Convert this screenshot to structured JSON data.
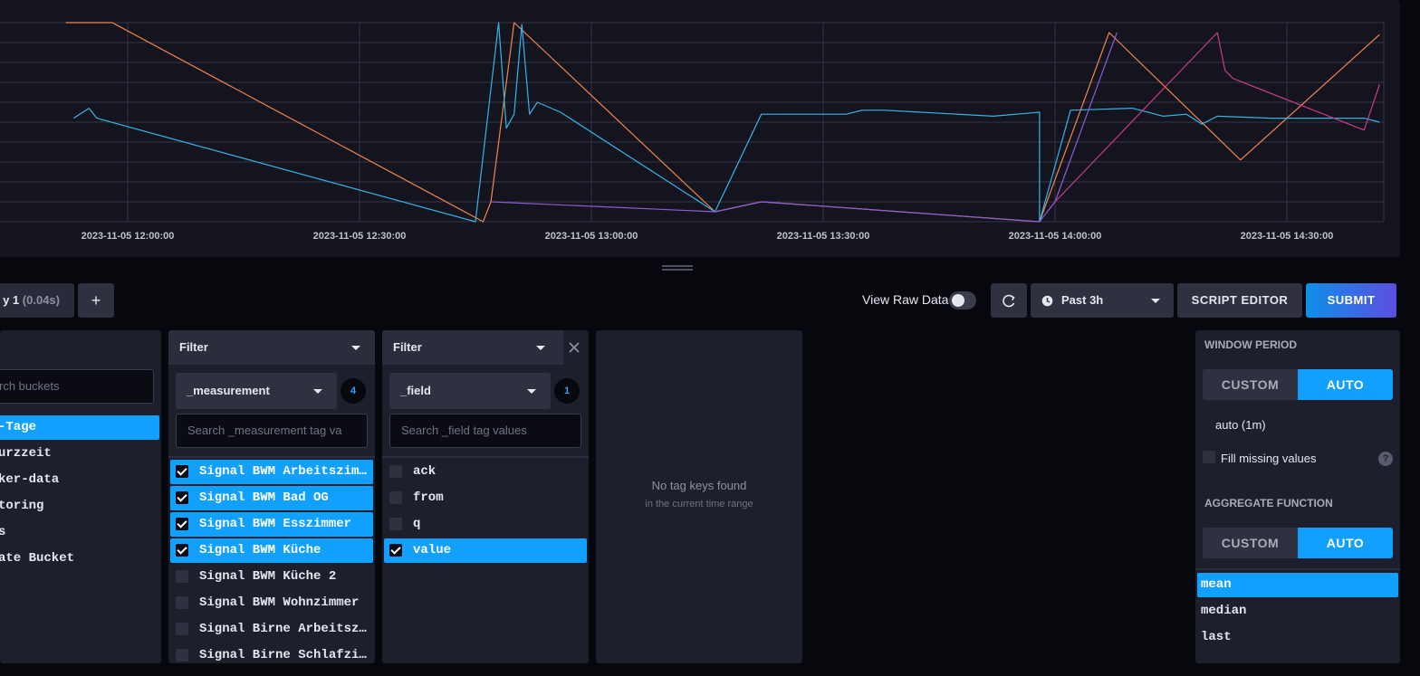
{
  "colors": {
    "background": "#07070e",
    "panel": "#14141f",
    "accent": "#12a0ff",
    "submit_gradient_start": "#0d8fe8",
    "submit_gradient_end": "#5c4ee0",
    "series_orange": "#f4844e",
    "series_cyan": "#35b4e8",
    "series_purple": "#8e5ad8",
    "series_magenta": "#c83b89"
  },
  "chart_data": {
    "type": "line",
    "x_tick_labels": [
      "2023-11-05 12:00:00",
      "2023-11-05 12:30:00",
      "2023-11-05 13:00:00",
      "2023-11-05 13:30:00",
      "2023-11-05 14:00:00",
      "2023-11-05 14:30:00"
    ],
    "x_range": [
      "2023-11-05 11:52",
      "2023-11-05 14:43"
    ],
    "y_range": [
      0,
      10
    ],
    "grid": true,
    "series": [
      {
        "color": "#f4844e",
        "points": [
          [
            "2023-11-05 11:52",
            10
          ],
          [
            "2023-11-05 11:58",
            10
          ],
          [
            "2023-11-05 12:46",
            0
          ],
          [
            "2023-11-05 12:47",
            1
          ],
          [
            "2023-11-05 12:50",
            10
          ],
          [
            "2023-11-05 13:16",
            0.5
          ],
          [
            "2023-11-05 13:22",
            1
          ],
          [
            "2023-11-05 13:58",
            0
          ],
          [
            "2023-11-05 14:07",
            9.5
          ],
          [
            "2023-11-05 14:24",
            3.1
          ],
          [
            "2023-11-05 14:42",
            9.4
          ]
        ]
      },
      {
        "color": "#35b4e8",
        "points": [
          [
            "2023-11-05 11:53",
            5.2
          ],
          [
            "2023-11-05 11:55",
            5.7
          ],
          [
            "2023-11-05 11:56",
            5.2
          ],
          [
            "2023-11-05 12:45",
            0
          ],
          [
            "2023-11-05 12:48",
            10
          ],
          [
            "2023-11-05 12:49",
            4.7
          ],
          [
            "2023-11-05 12:50",
            5.4
          ],
          [
            "2023-11-05 12:51",
            9.9
          ],
          [
            "2023-11-05 12:52",
            5.4
          ],
          [
            "2023-11-05 12:53",
            6
          ],
          [
            "2023-11-05 12:56",
            5.5
          ],
          [
            "2023-11-05 13:16",
            0.5
          ],
          [
            "2023-11-05 13:22",
            5.4
          ],
          [
            "2023-11-05 13:33",
            5.4
          ],
          [
            "2023-11-05 13:35",
            5.6
          ],
          [
            "2023-11-05 13:38",
            5.6
          ],
          [
            "2023-11-05 13:52",
            5.3
          ],
          [
            "2023-11-05 13:58",
            5.5
          ],
          [
            "2023-11-05 13:58",
            0
          ],
          [
            "2023-11-05 14:02",
            5.6
          ],
          [
            "2023-11-05 14:10",
            5.7
          ],
          [
            "2023-11-05 14:14",
            5.3
          ],
          [
            "2023-11-05 14:17",
            5.4
          ],
          [
            "2023-11-05 14:19",
            4.9
          ],
          [
            "2023-11-05 14:21",
            5.3
          ],
          [
            "2023-11-05 14:28",
            5.2
          ],
          [
            "2023-11-05 14:40",
            5.2
          ],
          [
            "2023-11-05 14:42",
            5
          ]
        ]
      },
      {
        "color": "#8e5ad8",
        "points": [
          [
            "2023-11-05 12:47",
            1
          ],
          [
            "2023-11-05 13:16",
            0.5
          ],
          [
            "2023-11-05 13:22",
            1
          ],
          [
            "2023-11-05 13:58",
            0
          ],
          [
            "2023-11-05 14:00",
            1
          ],
          [
            "2023-11-05 14:08",
            9.5
          ]
        ]
      },
      {
        "color": "#c83b89",
        "points": [
          [
            "2023-11-05 14:00",
            1
          ],
          [
            "2023-11-05 14:21",
            9.5
          ],
          [
            "2023-11-05 14:22",
            7.6
          ],
          [
            "2023-11-05 14:23",
            7.2
          ],
          [
            "2023-11-05 14:40",
            4.6
          ],
          [
            "2023-11-05 14:42",
            6.9
          ]
        ]
      }
    ]
  },
  "toolbar": {
    "query_tab_label": "y 1",
    "query_tab_time": "(0.04s)",
    "add_label": "+",
    "view_raw_label": "View Raw Data",
    "time_range_label": "Past 3h",
    "script_editor_label": "SCRIPT EDITOR",
    "submit_label": "SUBMIT"
  },
  "buckets": {
    "search_placeholder": "rch buckets",
    "items": [
      {
        "label": "-Tage",
        "selected": true
      },
      {
        "label": "urzzeit",
        "selected": false
      },
      {
        "label": "ker-data",
        "selected": false
      },
      {
        "label": "toring",
        "selected": false
      },
      {
        "label": "s",
        "selected": false
      },
      {
        "label": "ate Bucket",
        "selected": false
      }
    ]
  },
  "filter1": {
    "title": "Filter",
    "key": "_measurement",
    "count": "4",
    "search_placeholder": "Search _measurement tag va",
    "items": [
      {
        "label": "Signal BWM Arbeitszim…",
        "checked": true
      },
      {
        "label": "Signal BWM Bad OG",
        "checked": true
      },
      {
        "label": "Signal BWM Esszimmer",
        "checked": true
      },
      {
        "label": "Signal BWM Küche",
        "checked": true
      },
      {
        "label": "Signal BWM Küche 2",
        "checked": false
      },
      {
        "label": "Signal BWM Wohnzimmer",
        "checked": false
      },
      {
        "label": "Signal Birne Arbeitsz…",
        "checked": false
      },
      {
        "label": "Signal Birne Schlafzi…",
        "checked": false
      }
    ]
  },
  "filter2": {
    "title": "Filter",
    "key": "_field",
    "count": "1",
    "search_placeholder": "Search _field tag values",
    "items": [
      {
        "label": "ack",
        "checked": false
      },
      {
        "label": "from",
        "checked": false
      },
      {
        "label": "q",
        "checked": false
      },
      {
        "label": "value",
        "checked": true
      }
    ]
  },
  "empty_panel": {
    "title": "No tag keys found",
    "subtitle": "in the current time range"
  },
  "aggregate": {
    "window_period_title": "WINDOW PERIOD",
    "custom_label": "CUSTOM",
    "auto_label": "AUTO",
    "auto_value": "auto (1m)",
    "fill_missing_label": "Fill missing values",
    "help_glyph": "?",
    "aggregate_function_title": "AGGREGATE FUNCTION",
    "functions": [
      {
        "label": "mean",
        "selected": true
      },
      {
        "label": "median",
        "selected": false
      },
      {
        "label": "last",
        "selected": false
      }
    ]
  }
}
